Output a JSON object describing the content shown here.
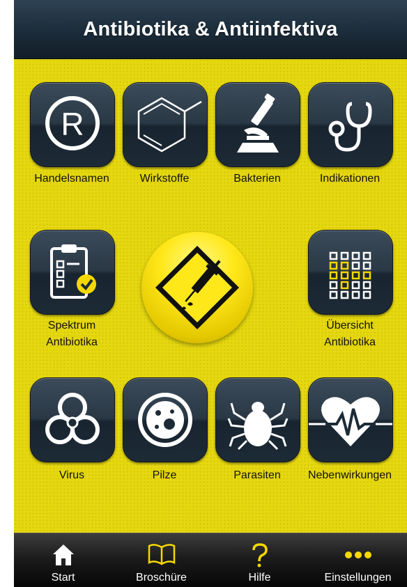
{
  "header": {
    "title": "Antibiotika & Antiinfektiva"
  },
  "grid": {
    "handelsnamen": "Handelsnamen",
    "wirkstoffe": "Wirkstoffe",
    "bakterien": "Bakterien",
    "indikationen": "Indikationen",
    "spektrum_line1": "Spektrum",
    "spektrum_line2": "Antibiotika",
    "uebersicht_line1": "Übersicht",
    "uebersicht_line2": "Antibiotika",
    "virus": "Virus",
    "pilze": "Pilze",
    "parasiten": "Parasiten",
    "nebenwirkungen": "Nebenwirkungen"
  },
  "tabbar": {
    "tabs": [
      {
        "label": "Start",
        "icon": "home-icon"
      },
      {
        "label": "Broschüre",
        "icon": "book-icon"
      },
      {
        "label": "Hilfe",
        "icon": "question-icon"
      },
      {
        "label": "Einstellungen",
        "icon": "more-dots-icon"
      }
    ]
  },
  "colors": {
    "accent": "#ffe81a",
    "background": "#e6d80f",
    "tile": "#25333f",
    "header": "#1d2e3c"
  }
}
